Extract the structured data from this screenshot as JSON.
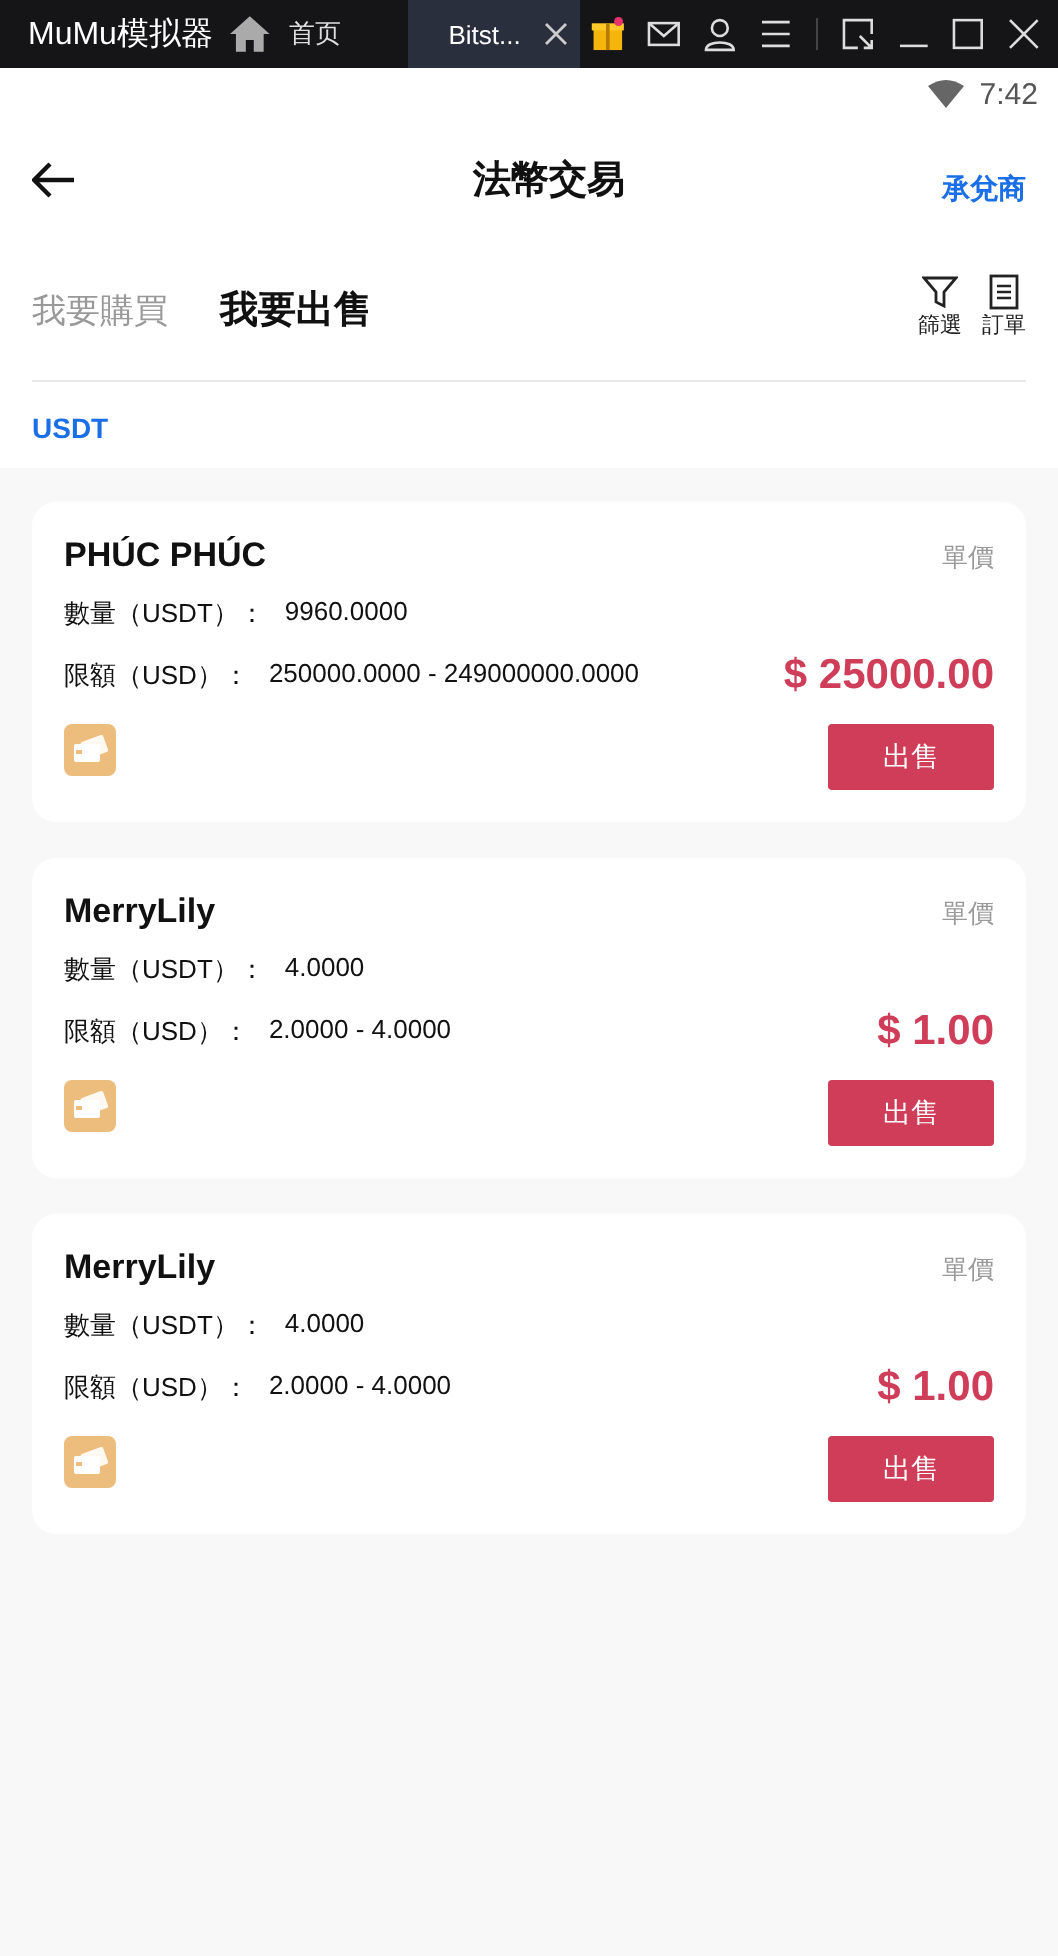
{
  "emulator_bar": {
    "app_name": "MuMu模拟器",
    "tabs": [
      {
        "label": "首页",
        "selected": false,
        "closable": false
      },
      {
        "label": "Bitst...",
        "selected": true,
        "closable": true
      }
    ]
  },
  "status_bar": {
    "time": "7:42"
  },
  "header": {
    "title": "法幣交易",
    "action": "承兌商"
  },
  "trade_tabs": [
    {
      "label": "我要購買",
      "selected": false
    },
    {
      "label": "我要出售",
      "selected": true
    }
  ],
  "tools": [
    {
      "kind": "filter",
      "label": "篩選"
    },
    {
      "kind": "orders",
      "label": "訂單"
    }
  ],
  "currency": "USDT",
  "offers": [
    {
      "name": "PHÚC PHÚC",
      "price_label": "單價",
      "quantity_label": "數量（USDT）：",
      "quantity": "9960.0000",
      "limit_label": "限額（USD）：",
      "limit": "250000.0000 - 249000000.0000",
      "price": "$ 25000.00",
      "button": "出售"
    },
    {
      "name": "MerryLily",
      "price_label": "單價",
      "quantity_label": "數量（USDT）：",
      "quantity": "4.0000",
      "limit_label": "限額（USD）：",
      "limit": "2.0000 - 4.0000",
      "price": "$ 1.00",
      "button": "出售"
    },
    {
      "name": "MerryLily",
      "price_label": "單價",
      "quantity_label": "數量（USDT）：",
      "quantity": "4.0000",
      "limit_label": "限額（USD）：",
      "limit": "2.0000 - 4.0000",
      "price": "$ 1.00",
      "button": "出售"
    }
  ]
}
